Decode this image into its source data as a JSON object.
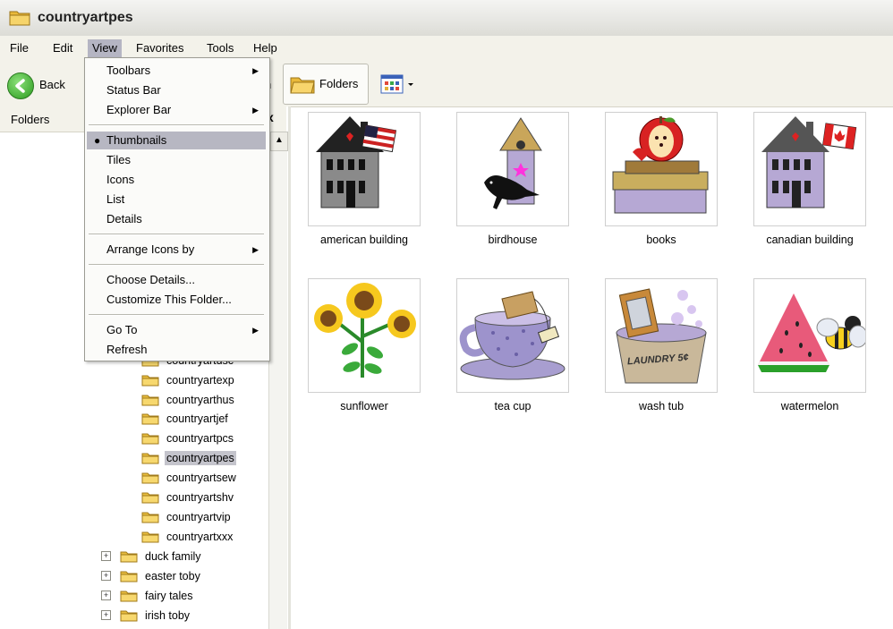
{
  "window": {
    "title": "countryartpes"
  },
  "menubar": [
    "File",
    "Edit",
    "View",
    "Favorites",
    "Tools",
    "Help"
  ],
  "toolbar": {
    "back_label": "Back",
    "folders_label": "Folders"
  },
  "sidepane": {
    "header": "Folders",
    "close_glyph": "x"
  },
  "view_menu": {
    "group1": [
      {
        "label": "Toolbars",
        "submenu": true
      },
      {
        "label": "Status Bar",
        "submenu": false
      },
      {
        "label": "Explorer Bar",
        "submenu": true
      }
    ],
    "group2": [
      {
        "label": "Thumbnails",
        "selected": true
      },
      {
        "label": "Tiles"
      },
      {
        "label": "Icons"
      },
      {
        "label": "List"
      },
      {
        "label": "Details"
      }
    ],
    "group3": [
      {
        "label": "Arrange Icons by",
        "submenu": true
      }
    ],
    "group4": [
      {
        "label": "Choose Details..."
      },
      {
        "label": "Customize This Folder..."
      }
    ],
    "group5": [
      {
        "label": "Go To",
        "submenu": true
      },
      {
        "label": "Refresh"
      }
    ]
  },
  "tree": {
    "subfolders": [
      "countryartusc",
      "countryartexp",
      "countryarthus",
      "countryartjef",
      "countryartpcs",
      "countryartpes",
      "countryartsew",
      "countryartshv",
      "countryartvip",
      "countryartxxx"
    ],
    "selected": "countryartpes",
    "top_folders": [
      "duck family",
      "easter toby",
      "fairy tales",
      "irish toby"
    ]
  },
  "thumbnails": [
    {
      "label": "american building",
      "icon": "american-building-icon"
    },
    {
      "label": "birdhouse",
      "icon": "birdhouse-icon"
    },
    {
      "label": "books",
      "icon": "books-icon"
    },
    {
      "label": "canadian building",
      "icon": "canadian-building-icon"
    },
    {
      "label": "sunflower",
      "icon": "sunflower-icon"
    },
    {
      "label": "tea cup",
      "icon": "tea-cup-icon"
    },
    {
      "label": "wash tub",
      "icon": "wash-tub-icon",
      "text": "LAUNDRY 5¢"
    },
    {
      "label": "watermelon",
      "icon": "watermelon-icon"
    }
  ],
  "colors": {
    "menu_highlight": "#b7b7c2",
    "chrome": "#f3f2ea",
    "folder": "#f5c842"
  }
}
